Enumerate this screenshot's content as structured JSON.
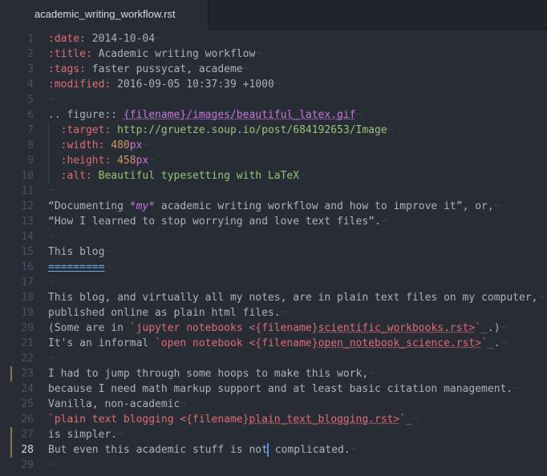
{
  "tab": {
    "title": "academic_writing_workflow.rst"
  },
  "editor": {
    "current_line": 28,
    "modified_lines": [
      23,
      27,
      28
    ],
    "lines": [
      {
        "n": "1",
        "segments": [
          {
            "t": ":date:",
            "c": "fld"
          },
          {
            "t": " 2014-10-04",
            "c": "val"
          },
          {
            "t": "¬",
            "c": "eol"
          }
        ]
      },
      {
        "n": "2",
        "segments": [
          {
            "t": ":title:",
            "c": "fld"
          },
          {
            "t": " Academic writing workflow",
            "c": "val"
          },
          {
            "t": "¬",
            "c": "eol"
          }
        ]
      },
      {
        "n": "3",
        "segments": [
          {
            "t": ":tags:",
            "c": "fld"
          },
          {
            "t": " faster pussycat, academe",
            "c": "val"
          },
          {
            "t": "¬",
            "c": "eol"
          }
        ]
      },
      {
        "n": "4",
        "segments": [
          {
            "t": ":modified:",
            "c": "fld"
          },
          {
            "t": " 2016-09-05 10:37:39 +1000",
            "c": "val"
          },
          {
            "t": "¬",
            "c": "eol"
          }
        ]
      },
      {
        "n": "5",
        "segments": [
          {
            "t": "¬",
            "c": "eol"
          }
        ]
      },
      {
        "n": "6",
        "segments": [
          {
            "t": ".. figure:: ",
            "c": "plain"
          },
          {
            "t": "{filename}/images/beautiful_latex.gif",
            "c": "fname"
          },
          {
            "t": "¬",
            "c": "eol"
          }
        ]
      },
      {
        "n": "7",
        "guide": true,
        "segments": [
          {
            "t": "  ",
            "c": "plain"
          },
          {
            "t": ":target:",
            "c": "fld"
          },
          {
            "t": " http://gruetze.soup.io/post/684192653/Image",
            "c": "url"
          },
          {
            "t": "¬",
            "c": "eol"
          }
        ]
      },
      {
        "n": "8",
        "guide": true,
        "segments": [
          {
            "t": "  ",
            "c": "plain"
          },
          {
            "t": ":width:",
            "c": "fld"
          },
          {
            "t": " ",
            "c": "plain"
          },
          {
            "t": "480",
            "c": "num"
          },
          {
            "t": "px",
            "c": "unit"
          },
          {
            "t": "¬",
            "c": "eol"
          }
        ]
      },
      {
        "n": "9",
        "guide": true,
        "segments": [
          {
            "t": "  ",
            "c": "plain"
          },
          {
            "t": ":height:",
            "c": "fld"
          },
          {
            "t": " ",
            "c": "plain"
          },
          {
            "t": "458",
            "c": "num"
          },
          {
            "t": "px",
            "c": "unit"
          },
          {
            "t": "¬",
            "c": "eol"
          }
        ]
      },
      {
        "n": "10",
        "guide": true,
        "segments": [
          {
            "t": "  ",
            "c": "plain"
          },
          {
            "t": ":alt:",
            "c": "fld"
          },
          {
            "t": " Beautiful typesetting with LaTeX",
            "c": "str"
          },
          {
            "t": "¬",
            "c": "eol"
          }
        ]
      },
      {
        "n": "11",
        "segments": [
          {
            "t": "¬",
            "c": "eol"
          }
        ]
      },
      {
        "n": "12",
        "segments": [
          {
            "t": "“Documenting ",
            "c": "plain"
          },
          {
            "t": "*my*",
            "c": "emph"
          },
          {
            "t": " academic writing workflow and how to improve it”, or,",
            "c": "plain"
          },
          {
            "t": "¬",
            "c": "eol"
          }
        ]
      },
      {
        "n": "13",
        "segments": [
          {
            "t": "“How I learned to stop worrying and love text files”.",
            "c": "plain"
          },
          {
            "t": "¬",
            "c": "eol"
          }
        ]
      },
      {
        "n": "14",
        "segments": [
          {
            "t": "¬",
            "c": "eol"
          }
        ]
      },
      {
        "n": "15",
        "segments": [
          {
            "t": "This blog",
            "c": "plain"
          },
          {
            "t": "¬",
            "c": "eol"
          }
        ]
      },
      {
        "n": "16",
        "segments": [
          {
            "t": "=========",
            "c": "ul"
          },
          {
            "t": "¬",
            "c": "eol"
          }
        ]
      },
      {
        "n": "17",
        "segments": [
          {
            "t": "¬",
            "c": "eol"
          }
        ]
      },
      {
        "n": "18",
        "segments": [
          {
            "t": "This blog, and virtually all my notes, are in plain text files on my computer,",
            "c": "plain"
          },
          {
            "t": "¬",
            "c": "eol"
          }
        ]
      },
      {
        "n": "19",
        "segments": [
          {
            "t": "published online as plain html files.",
            "c": "plain"
          },
          {
            "t": "¬",
            "c": "eol"
          }
        ]
      },
      {
        "n": "20",
        "segments": [
          {
            "t": "(Some are in ",
            "c": "plain"
          },
          {
            "t": "`jupyter notebooks <{filename}",
            "c": "link"
          },
          {
            "t": "scientific_workbooks.rst>",
            "c": "linkc"
          },
          {
            "t": "`_",
            "c": "link"
          },
          {
            "t": ".)",
            "c": "plain"
          },
          {
            "t": "¬",
            "c": "eol"
          }
        ]
      },
      {
        "n": "21",
        "segments": [
          {
            "t": "It's an informal ",
            "c": "plain"
          },
          {
            "t": "`open notebook <{filename}",
            "c": "link"
          },
          {
            "t": "open_notebook_science.rst>",
            "c": "linkc"
          },
          {
            "t": "`_",
            "c": "link"
          },
          {
            "t": ".",
            "c": "plain"
          },
          {
            "t": "¬",
            "c": "eol"
          }
        ]
      },
      {
        "n": "22",
        "segments": [
          {
            "t": "¬",
            "c": "eol"
          }
        ]
      },
      {
        "n": "23",
        "segments": [
          {
            "t": "I had to jump through some hoops to make this work,",
            "c": "plain"
          },
          {
            "t": "¬",
            "c": "eol"
          }
        ]
      },
      {
        "n": "24",
        "segments": [
          {
            "t": "because I need math markup support and at least basic citation management.",
            "c": "plain"
          },
          {
            "t": "¬",
            "c": "eol"
          }
        ]
      },
      {
        "n": "25",
        "segments": [
          {
            "t": "Vanilla, non-academic",
            "c": "plain"
          },
          {
            "t": "¬",
            "c": "eol"
          }
        ]
      },
      {
        "n": "26",
        "segments": [
          {
            "t": "`plain text blogging <{filename}",
            "c": "link"
          },
          {
            "t": "plain_text_blogging.rst>",
            "c": "linkc"
          },
          {
            "t": "`_",
            "c": "link"
          },
          {
            "t": "¬",
            "c": "eol"
          }
        ]
      },
      {
        "n": "27",
        "segments": [
          {
            "t": "is simpler.",
            "c": "plain"
          },
          {
            "t": "¬",
            "c": "eol"
          }
        ]
      },
      {
        "n": "28",
        "cursor_after": 0,
        "segments": [
          {
            "t": "But even this academic stuff is not",
            "c": "plain"
          },
          {
            "t": " complicated.",
            "c": "plain"
          },
          {
            "t": "¬",
            "c": "eol"
          }
        ]
      },
      {
        "n": "29",
        "segments": [
          {
            "t": "¬",
            "c": "eol"
          }
        ]
      }
    ]
  }
}
